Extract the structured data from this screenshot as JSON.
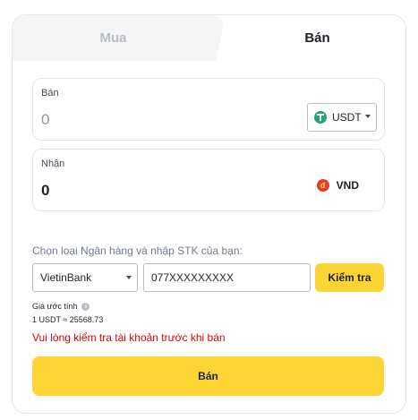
{
  "tabs": {
    "buy_label": "Mua",
    "sell_label": "Bán",
    "active": "sell"
  },
  "sell_field": {
    "label": "Bán",
    "placeholder": "0",
    "currency": "USDT",
    "currency_icon": "tether-icon"
  },
  "receive_field": {
    "label": "Nhận",
    "value": "0",
    "currency": "VND",
    "currency_icon": "vnd-icon",
    "currency_icon_glyph": "đ"
  },
  "bank": {
    "prompt": "Chọn loại Ngân hàng và nhập STK của bạn:",
    "selected_bank": "VietinBank",
    "account_number": "077XXXXXXXXX",
    "check_label": "Kiểm tra"
  },
  "estimate": {
    "label": "Giá ước tính",
    "value": "1 USDT ≈ 25568.73"
  },
  "warning": "Vui lòng kiểm tra tài khoản trước khi bán",
  "submit_label": "Bán",
  "colors": {
    "accent": "#fcd535",
    "warning": "#e00000",
    "usdt": "#26a17b",
    "vnd": "#e8382f"
  }
}
